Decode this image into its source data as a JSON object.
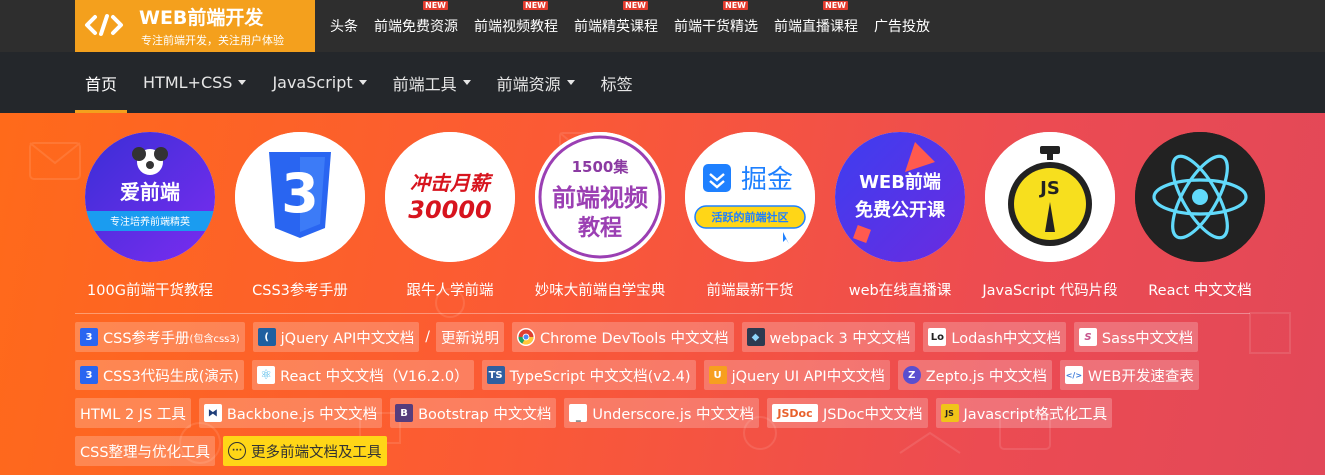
{
  "logo": {
    "title": "WEB前端开发",
    "subtitle": "专注前端开发，关注用户体验"
  },
  "top_nav": {
    "items": [
      {
        "label": "头条",
        "badge": ""
      },
      {
        "label": "前端免费资源",
        "badge": "NEW"
      },
      {
        "label": "前端视频教程",
        "badge": "NEW"
      },
      {
        "label": "前端精英课程",
        "badge": "NEW"
      },
      {
        "label": "前端干货精选",
        "badge": "NEW"
      },
      {
        "label": "前端直播课程",
        "badge": "NEW"
      },
      {
        "label": "广告投放",
        "badge": ""
      }
    ]
  },
  "sub_nav": {
    "items": [
      {
        "label": "首页",
        "dropdown": false,
        "active": true
      },
      {
        "label": "HTML+CSS",
        "dropdown": true,
        "active": false
      },
      {
        "label": "JavaScript",
        "dropdown": true,
        "active": false
      },
      {
        "label": "前端工具",
        "dropdown": true,
        "active": false
      },
      {
        "label": "前端资源",
        "dropdown": true,
        "active": false
      },
      {
        "label": "标签",
        "dropdown": false,
        "active": false
      }
    ]
  },
  "tiles": [
    {
      "label": "100G前端干货教程",
      "art": {
        "title": "爱前端",
        "tag": "专注培养前端精英"
      }
    },
    {
      "label": "CSS3参考手册",
      "art": {
        "title": "3"
      }
    },
    {
      "label": "跟牛人学前端",
      "art": {
        "line1": "冲击月薪",
        "line2": "30000"
      }
    },
    {
      "label": "妙味大前端自学宝典",
      "art": {
        "line1": "1500集",
        "line2": "前端视频",
        "line3": "教程"
      }
    },
    {
      "label": "前端最新干货",
      "art": {
        "title": "掘金",
        "tag": "活跃的前端社区"
      }
    },
    {
      "label": "web在线直播课",
      "art": {
        "line1": "WEB前端",
        "line2": "免费公开课"
      }
    },
    {
      "label": "JavaScript 代码片段",
      "art": {
        "title": "JS"
      }
    },
    {
      "label": "React 中文文档",
      "art": {}
    }
  ],
  "doc_links": {
    "row1": [
      {
        "label": "CSS参考手册",
        "small": "(包含css3)",
        "icon": "css3-icon",
        "color": "#2965f1",
        "glyph": "3"
      },
      {
        "label": "jQuery API中文文档",
        "icon": "jquery-icon",
        "color": "#1f5fa0",
        "glyph": "("
      },
      {
        "label": "更新说明",
        "icon": "",
        "color": "",
        "glyph": ""
      },
      {
        "label": "Chrome DevTools 中文文档",
        "icon": "chrome-icon",
        "color": "#de3f31",
        "glyph": "●"
      },
      {
        "label": "webpack 3 中文文档",
        "icon": "webpack-icon",
        "color": "#5b8fc7",
        "glyph": "◆"
      },
      {
        "label": "Lodash中文文档",
        "icon": "lodash-icon",
        "color": "#ffffff",
        "glyph": "Lo"
      },
      {
        "label": "Sass中文文档",
        "icon": "sass-icon",
        "color": "#ffffff",
        "glyph": "S"
      }
    ],
    "row1_separator": "/",
    "row2": [
      {
        "label": "CSS3代码生成(演示)",
        "icon": "css3-icon",
        "color": "#2965f1",
        "glyph": "3"
      },
      {
        "label": "React 中文文档（V16.2.0）",
        "icon": "react-icon",
        "color": "#ffffff",
        "glyph": "⚛"
      },
      {
        "label": "TypeScript 中文文档(v2.4)",
        "icon": "typescript-icon",
        "color": "#2f5f9f",
        "glyph": "TS"
      },
      {
        "label": "jQuery UI API中文文档",
        "icon": "jquery-ui-icon",
        "color": "#f79f1f",
        "glyph": "U"
      },
      {
        "label": "Zepto.js 中文文档",
        "icon": "zepto-icon",
        "color": "#5a4fcf",
        "glyph": "Z"
      },
      {
        "label": "WEB开发速查表",
        "icon": "code-icon",
        "color": "#ffffff",
        "glyph": "</>"
      }
    ],
    "row3": [
      {
        "label": "HTML 2 JS 工具",
        "icon": "",
        "color": "",
        "glyph": ""
      },
      {
        "label": "Backbone.js 中文文档",
        "icon": "backbone-icon",
        "color": "#1f3f7a",
        "glyph": "⧓"
      },
      {
        "label": "Bootstrap 中文文档",
        "icon": "bootstrap-icon",
        "color": "#563d7c",
        "glyph": "B"
      },
      {
        "label": "Underscore.js 中文文档",
        "icon": "underscore-icon",
        "color": "#ffffff",
        "glyph": "_"
      },
      {
        "label": "JSDoc中文文档",
        "icon": "jsdoc-icon",
        "color": "#ffffff",
        "glyph": "JSDoc"
      },
      {
        "label": "Javascript格式化工具",
        "icon": "js-format-icon",
        "color": "#f0c419",
        "glyph": "JS"
      }
    ],
    "row4": [
      {
        "label": "CSS整理与优化工具",
        "icon": "",
        "color": "",
        "glyph": ""
      },
      {
        "label": "更多前端文档及工具",
        "icon": "more-icon",
        "color": "#ffd617",
        "glyph": "···",
        "highlight": true
      }
    ]
  }
}
